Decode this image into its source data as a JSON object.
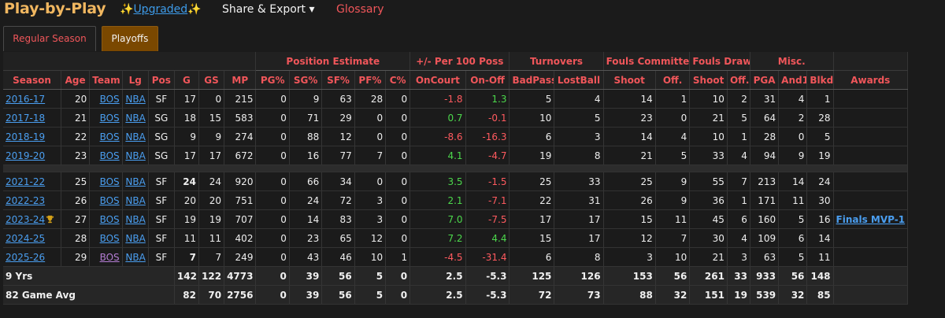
{
  "header": {
    "title": "Play-by-Play",
    "upgraded_prefix": "✨",
    "upgraded_label": "Upgraded",
    "upgraded_suffix": "✨",
    "share_label": "Share & Export ▾",
    "glossary_label": "Glossary"
  },
  "tabs": [
    {
      "label": "Regular Season",
      "active": false
    },
    {
      "label": "Playoffs",
      "active": true
    }
  ],
  "groups": {
    "position_estimate": "Position Estimate",
    "plus_minus": "+/- Per 100 Poss",
    "turnovers": "Turnovers",
    "fouls_committed": "Fouls Committed",
    "fouls_drawn": "Fouls Drawn",
    "misc": "Misc."
  },
  "columns": [
    "Season",
    "Age",
    "Team",
    "Lg",
    "Pos",
    "G",
    "GS",
    "MP",
    "PG%",
    "SG%",
    "SF%",
    "PF%",
    "C%",
    "OnCourt",
    "On-Off",
    "BadPass",
    "LostBall",
    "Shoot",
    "Off.",
    "Shoot",
    "Off.",
    "PGA",
    "And1",
    "Blkd",
    "Awards"
  ],
  "rows": [
    {
      "season": "2016-17",
      "age": "20",
      "team": "BOS",
      "lg": "NBA",
      "pos": "SF",
      "g": "17",
      "gs": "0",
      "mp": "215",
      "pg": "0",
      "sg": "9",
      "sf": "63",
      "pf": "28",
      "c": "0",
      "oncourt": "-1.8",
      "onoff": "1.3",
      "badpass": "5",
      "lostball": "4",
      "fc_shoot": "14",
      "fc_off": "1",
      "fd_shoot": "10",
      "fd_off": "2",
      "pga": "31",
      "and1": "4",
      "blkd": "1",
      "awards": ""
    },
    {
      "season": "2017-18",
      "age": "21",
      "team": "BOS",
      "lg": "NBA",
      "pos": "SG",
      "g": "18",
      "gs": "15",
      "mp": "583",
      "pg": "0",
      "sg": "71",
      "sf": "29",
      "pf": "0",
      "c": "0",
      "oncourt": "0.7",
      "onoff": "-0.1",
      "badpass": "10",
      "lostball": "5",
      "fc_shoot": "23",
      "fc_off": "0",
      "fd_shoot": "21",
      "fd_off": "5",
      "pga": "64",
      "and1": "2",
      "blkd": "28",
      "awards": ""
    },
    {
      "season": "2018-19",
      "age": "22",
      "team": "BOS",
      "lg": "NBA",
      "pos": "SG",
      "g": "9",
      "gs": "9",
      "mp": "274",
      "pg": "0",
      "sg": "88",
      "sf": "12",
      "pf": "0",
      "c": "0",
      "oncourt": "-8.6",
      "onoff": "-16.3",
      "badpass": "6",
      "lostball": "3",
      "fc_shoot": "14",
      "fc_off": "4",
      "fd_shoot": "10",
      "fd_off": "1",
      "pga": "28",
      "and1": "0",
      "blkd": "5",
      "awards": ""
    },
    {
      "season": "2019-20",
      "age": "23",
      "team": "BOS",
      "lg": "NBA",
      "pos": "SG",
      "g": "17",
      "gs": "17",
      "mp": "672",
      "pg": "0",
      "sg": "16",
      "sf": "77",
      "pf": "7",
      "c": "0",
      "oncourt": "4.1",
      "onoff": "-4.7",
      "badpass": "19",
      "lostball": "8",
      "fc_shoot": "21",
      "fc_off": "5",
      "fd_shoot": "33",
      "fd_off": "4",
      "pga": "94",
      "and1": "9",
      "blkd": "19",
      "awards": ""
    },
    {
      "spacer": true
    },
    {
      "season": "2021-22",
      "age": "25",
      "team": "BOS",
      "lg": "NBA",
      "pos": "SF",
      "g": "24",
      "gs": "24",
      "mp": "920",
      "pg": "0",
      "sg": "66",
      "sf": "34",
      "pf": "0",
      "c": "0",
      "oncourt": "3.5",
      "onoff": "-1.5",
      "badpass": "25",
      "lostball": "33",
      "fc_shoot": "25",
      "fc_off": "9",
      "fd_shoot": "55",
      "fd_off": "7",
      "pga": "213",
      "and1": "14",
      "blkd": "24",
      "awards": "",
      "g_bold": true
    },
    {
      "season": "2022-23",
      "age": "26",
      "team": "BOS",
      "lg": "NBA",
      "pos": "SF",
      "g": "20",
      "gs": "20",
      "mp": "751",
      "pg": "0",
      "sg": "24",
      "sf": "72",
      "pf": "3",
      "c": "0",
      "oncourt": "2.1",
      "onoff": "-7.1",
      "badpass": "22",
      "lostball": "31",
      "fc_shoot": "26",
      "fc_off": "9",
      "fd_shoot": "36",
      "fd_off": "1",
      "pga": "171",
      "and1": "11",
      "blkd": "30",
      "awards": ""
    },
    {
      "season": "2023-24",
      "trophy": true,
      "age": "27",
      "team": "BOS",
      "lg": "NBA",
      "pos": "SF",
      "g": "19",
      "gs": "19",
      "mp": "707",
      "pg": "0",
      "sg": "14",
      "sf": "83",
      "pf": "3",
      "c": "0",
      "oncourt": "7.0",
      "onoff": "-7.5",
      "badpass": "17",
      "lostball": "17",
      "fc_shoot": "15",
      "fc_off": "11",
      "fd_shoot": "45",
      "fd_off": "6",
      "pga": "160",
      "and1": "5",
      "blkd": "16",
      "awards": "Finals MVP-1"
    },
    {
      "season": "2024-25",
      "age": "28",
      "team": "BOS",
      "lg": "NBA",
      "pos": "SF",
      "g": "11",
      "gs": "11",
      "mp": "402",
      "pg": "0",
      "sg": "23",
      "sf": "65",
      "pf": "12",
      "c": "0",
      "oncourt": "7.2",
      "onoff": "4.4",
      "badpass": "15",
      "lostball": "17",
      "fc_shoot": "12",
      "fc_off": "7",
      "fd_shoot": "30",
      "fd_off": "4",
      "pga": "109",
      "and1": "6",
      "blkd": "14",
      "awards": ""
    },
    {
      "season": "2025-26",
      "age": "29",
      "team": "BOS",
      "team_visited": true,
      "lg": "NBA",
      "pos": "SF",
      "g": "7",
      "gs": "7",
      "mp": "249",
      "pg": "0",
      "sg": "43",
      "sf": "46",
      "pf": "10",
      "c": "1",
      "oncourt": "-4.5",
      "onoff": "-31.4",
      "badpass": "6",
      "lostball": "8",
      "fc_shoot": "3",
      "fc_off": "10",
      "fd_shoot": "21",
      "fd_off": "3",
      "pga": "63",
      "and1": "5",
      "blkd": "11",
      "awards": "",
      "g_bold": true
    }
  ],
  "totals": [
    {
      "label": "9 Yrs",
      "g": "142",
      "gs": "122",
      "mp": "4773",
      "pg": "0",
      "sg": "39",
      "sf": "56",
      "pf": "5",
      "c": "0",
      "oncourt": "2.5",
      "onoff": "-5.3",
      "badpass": "125",
      "lostball": "126",
      "fc_shoot": "153",
      "fc_off": "56",
      "fd_shoot": "261",
      "fd_off": "33",
      "pga": "933",
      "and1": "56",
      "blkd": "148"
    },
    {
      "label": "82 Game Avg",
      "g": "82",
      "gs": "70",
      "mp": "2756",
      "pg": "0",
      "sg": "39",
      "sf": "56",
      "pf": "5",
      "c": "0",
      "oncourt": "2.5",
      "onoff": "-5.3",
      "badpass": "72",
      "lostball": "73",
      "fc_shoot": "88",
      "fc_off": "32",
      "fd_shoot": "151",
      "fd_off": "19",
      "pga": "539",
      "and1": "32",
      "blkd": "85"
    }
  ],
  "colors": {
    "accent_orange": "#f1b760",
    "link_blue": "#4a9ef0",
    "negative_red": "#ff5a5f",
    "positive_green": "#4cd84c",
    "active_tab": "#7a4800"
  }
}
